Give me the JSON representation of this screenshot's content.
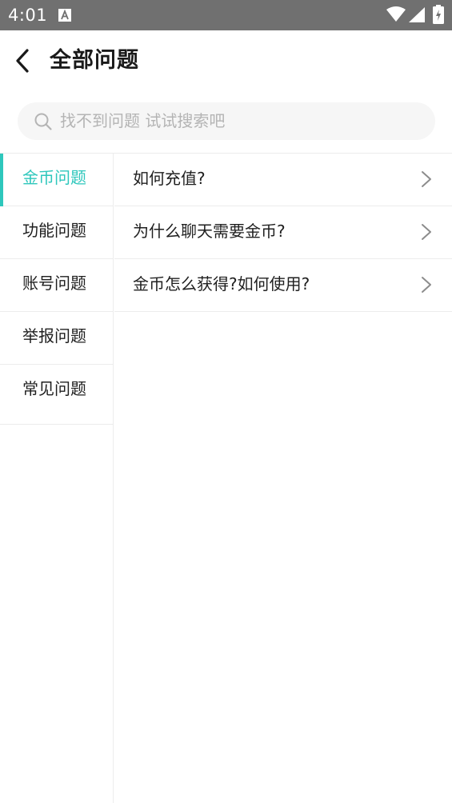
{
  "status_bar": {
    "time": "4:01",
    "notification_icon": "text-a-icon",
    "icons": [
      "wifi-icon",
      "signal-icon",
      "battery-charging-icon"
    ]
  },
  "header": {
    "back_icon": "chevron-left-icon",
    "title": "全部问题"
  },
  "search": {
    "icon": "search-icon",
    "placeholder": "找不到问题 试试搜索吧"
  },
  "categories": [
    {
      "label": "金币问题",
      "active": true
    },
    {
      "label": "功能问题",
      "active": false
    },
    {
      "label": "账号问题",
      "active": false
    },
    {
      "label": "举报问题",
      "active": false
    },
    {
      "label": "常见问题",
      "active": false
    }
  ],
  "questions": [
    {
      "label": "如何充值?"
    },
    {
      "label": "为什么聊天需要金币?"
    },
    {
      "label": "金币怎么获得?如何使用?"
    }
  ],
  "colors": {
    "accent": "#2ec7bc",
    "status_bar": "#707070",
    "text": "#1f1f1f",
    "placeholder": "#b4b4b4",
    "divider": "#ececec",
    "search_bg": "#f6f6f6"
  }
}
